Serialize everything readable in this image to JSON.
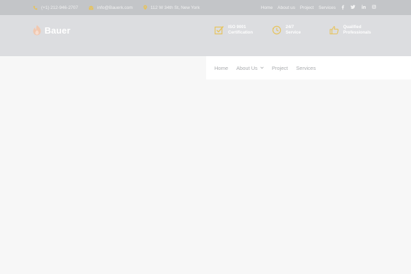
{
  "topbar": {
    "phone": "(+1) 212-946-2707",
    "email": "info@Bauerk.com",
    "address": "112 W 34th St, New York",
    "links": [
      "Home",
      "About us",
      "Project",
      "Services"
    ]
  },
  "brand": {
    "name": "Bauer",
    "accent": "#e7c35a",
    "logo_color": "#f1c8b0"
  },
  "features": [
    {
      "line1": "ISO 9001",
      "line2": "Certification",
      "icon": "checkbox-icon"
    },
    {
      "line1": "24/7",
      "line2": "Service",
      "icon": "clock-icon"
    },
    {
      "line1": "Qualified",
      "line2": "Professionals",
      "icon": "thumbs-up-icon"
    }
  ],
  "nav": {
    "items": [
      "Home",
      "About Us",
      "Project",
      "Services"
    ]
  },
  "social": [
    "facebook-icon",
    "twitter-icon",
    "linkedin-icon",
    "instagram-icon"
  ]
}
